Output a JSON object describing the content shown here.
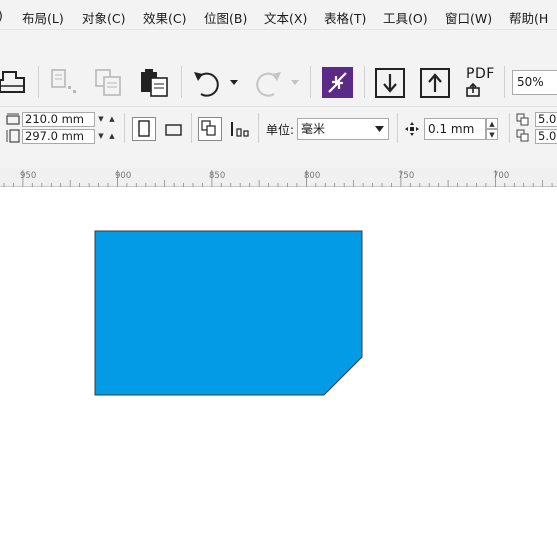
{
  "menu": {
    "items": [
      {
        "label": ")"
      },
      {
        "label": "布局(L)"
      },
      {
        "label": "对象(C)"
      },
      {
        "label": "效果(C)"
      },
      {
        "label": "位图(B)"
      },
      {
        "label": "文本(X)"
      },
      {
        "label": "表格(T)"
      },
      {
        "label": "工具(O)"
      },
      {
        "label": "窗口(W)"
      },
      {
        "label": "帮助(H"
      }
    ]
  },
  "toolbar": {
    "pdf_label": "PDF",
    "zoom_value": "50%"
  },
  "property_bar": {
    "page_width": "210.0 mm",
    "page_height": "297.0 mm",
    "units_label": "单位:",
    "units_value": "毫米",
    "nudge_value": "0.1 mm",
    "duplicate_x": "5.0",
    "duplicate_y": "5.0"
  },
  "ruler": {
    "labels": [
      "950",
      "900",
      "850",
      "800",
      "750",
      "700"
    ]
  },
  "canvas": {
    "shape_fill": "#039be5",
    "shape_stroke": "#3a3a3a"
  },
  "colors": {
    "accent_purple": "#5b2a86"
  }
}
